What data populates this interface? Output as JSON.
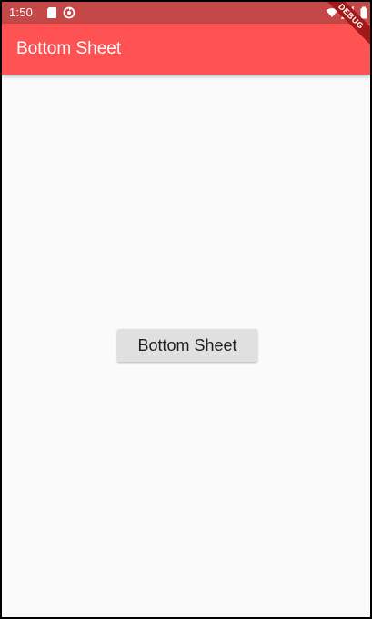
{
  "status_bar": {
    "time": "1:50",
    "icons": [
      "sd-card-icon",
      "sync-icon",
      "wifi-icon",
      "signal-icon",
      "battery-icon"
    ]
  },
  "app_bar": {
    "title": "Bottom Sheet",
    "color": "#ff5252"
  },
  "main": {
    "button_label": "Bottom Sheet"
  },
  "debug_banner": {
    "label": "DEBUG",
    "color": "#a31919"
  }
}
